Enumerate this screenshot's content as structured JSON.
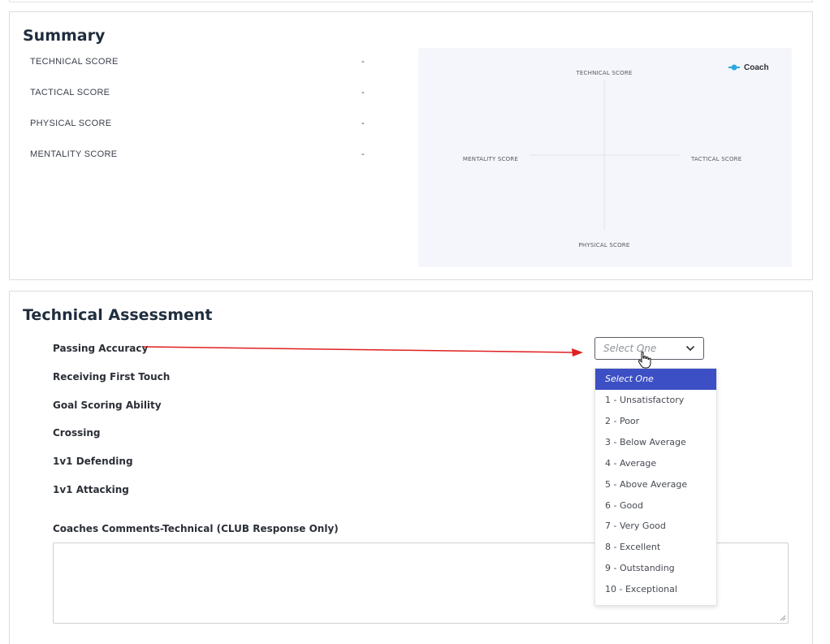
{
  "summary": {
    "title": "Summary",
    "scores": [
      {
        "label": "TECHNICAL SCORE",
        "value": "-"
      },
      {
        "label": "TACTICAL SCORE",
        "value": "-"
      },
      {
        "label": "PHYSICAL SCORE",
        "value": "-"
      },
      {
        "label": "MENTALITY SCORE",
        "value": "-"
      }
    ],
    "radar": {
      "axis_top": "TECHNICAL SCORE",
      "axis_right": "TACTICAL SCORE",
      "axis_bottom": "PHYSICAL SCORE",
      "axis_left": "MENTALITY SCORE",
      "legend_label": "Coach",
      "legend_color": "#29a9e0"
    }
  },
  "technical": {
    "title": "Technical Assessment",
    "criteria": [
      "Passing Accuracy",
      "Receiving First Touch",
      "Goal Scoring Ability",
      "Crossing",
      "1v1 Defending",
      "1v1 Attacking"
    ],
    "comments_label": "Coaches Comments-Technical (CLUB Response Only)",
    "comments_value": ""
  },
  "select": {
    "placeholder": "Select One",
    "icon": "chevron-down-icon",
    "options": [
      "Select One",
      "1 - Unsatisfactory",
      "2 - Poor",
      "3 - Below Average",
      "4 - Average",
      "5 - Above Average",
      "6 - Good",
      "7 - Very Good",
      "8 - Excellent",
      "9 - Outstanding",
      "10 - Exceptional"
    ],
    "highlighted_index": 0
  },
  "colors": {
    "highlight": "#3c4fc4",
    "annotation_arrow": "#e02020"
  }
}
